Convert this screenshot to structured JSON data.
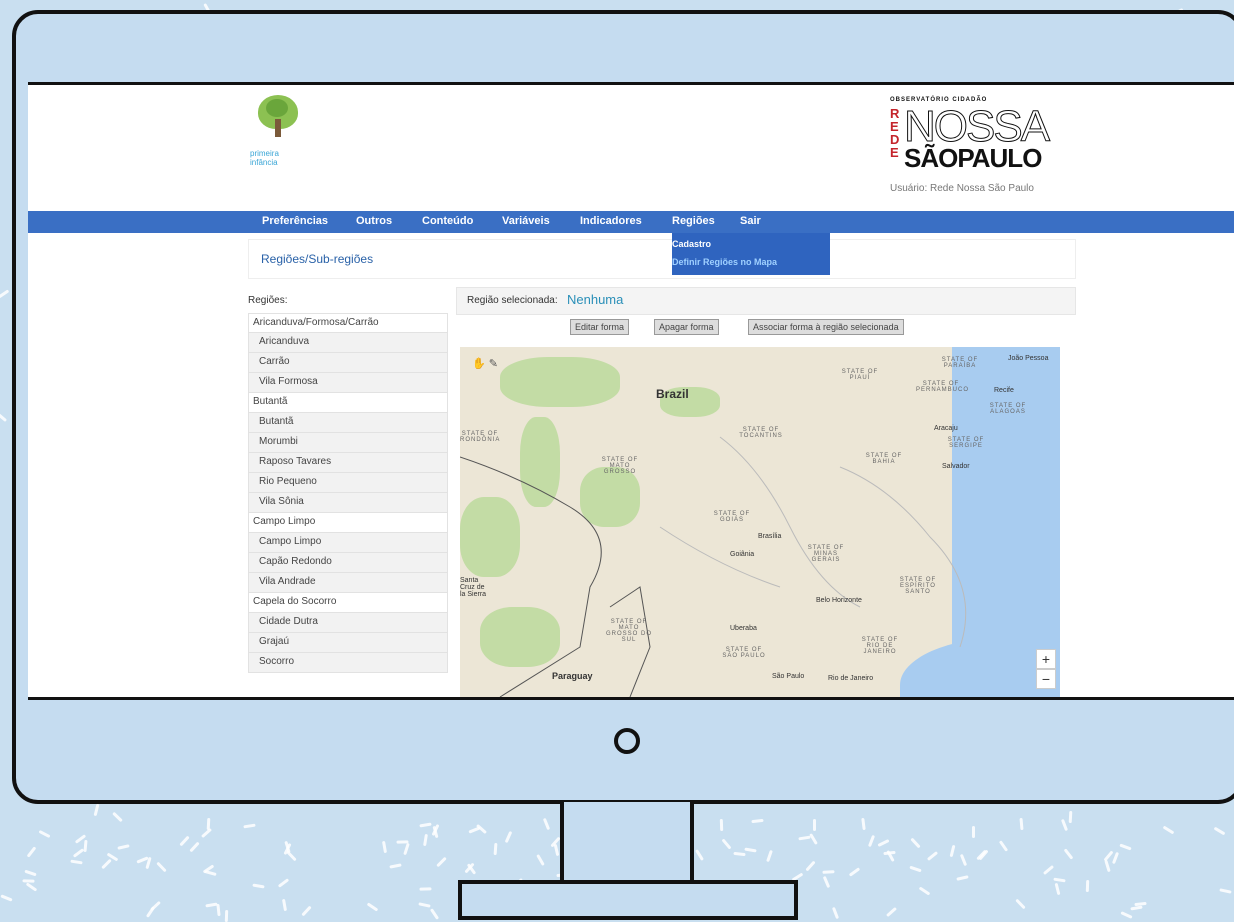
{
  "site": {
    "logo_left_text": "primeira infância",
    "logo_right_top": "OBSERVATÓRIO CIDADÃO",
    "logo_right_rede": "REDE",
    "logo_right_nossa": "NOSSA",
    "logo_right_sp": "SÃOPAULO",
    "user_label": "Usuário: Rede Nossa São Paulo"
  },
  "nav": {
    "items": [
      "Preferências",
      "Outros",
      "Conteúdo",
      "Variáveis",
      "Indicadores",
      "Regiões",
      "Sair"
    ],
    "dropdown": [
      "Cadastro",
      "Definir Regiões no Mapa"
    ]
  },
  "page": {
    "title": "Regiões/Sub-regiões",
    "regions_label": "Regiões:",
    "selected_label": "Região selecionada:",
    "selected_value": "Nenhuma",
    "buttons": [
      "Editar forma",
      "Apagar forma",
      "Associar forma à região selecionada"
    ]
  },
  "regions": [
    {
      "name": "Aricanduva/Formosa/Carrão",
      "sub": false
    },
    {
      "name": "Aricanduva",
      "sub": true
    },
    {
      "name": "Carrão",
      "sub": true
    },
    {
      "name": "Vila Formosa",
      "sub": true
    },
    {
      "name": "Butantã",
      "sub": false
    },
    {
      "name": "Butantã",
      "sub": true
    },
    {
      "name": "Morumbi",
      "sub": true
    },
    {
      "name": "Raposo Tavares",
      "sub": true
    },
    {
      "name": "Rio Pequeno",
      "sub": true
    },
    {
      "name": "Vila Sônia",
      "sub": true
    },
    {
      "name": "Campo Limpo",
      "sub": false
    },
    {
      "name": "Campo Limpo",
      "sub": true
    },
    {
      "name": "Capão Redondo",
      "sub": true
    },
    {
      "name": "Vila Andrade",
      "sub": true
    },
    {
      "name": "Capela do Socorro",
      "sub": false
    },
    {
      "name": "Cidade Dutra",
      "sub": true
    },
    {
      "name": "Grajaú",
      "sub": true
    },
    {
      "name": "Socorro",
      "sub": true
    }
  ],
  "map": {
    "country_brazil": "Brazil",
    "country_paraguay": "Paraguay",
    "states": [
      "STATE OF PIAUÍ",
      "STATE OF PARAÍBA",
      "STATE OF PERNAMBUCO",
      "STATE OF ALAGOAS",
      "STATE OF SERGIPE",
      "STATE OF TOCANTINS",
      "STATE OF MATO GROSSO",
      "STATE OF BAHIA",
      "STATE OF GOIÁS",
      "STATE OF MINAS GERAIS",
      "STATE OF ESPÍRITO SANTO",
      "STATE OF MATO GROSSO DO SUL",
      "STATE OF SÃO PAULO",
      "STATE OF RIO DE JANEIRO",
      "STATE OF RONDÔNIA"
    ],
    "cities": [
      "João Pessoa",
      "Recife",
      "Aracaju",
      "Salvador",
      "Brasília",
      "Goiânia",
      "Belo Horizonte",
      "São Paulo",
      "Rio de Janeiro",
      "Santa Cruz de la Sierra",
      "Uberaba"
    ],
    "zoom_in": "+",
    "zoom_out": "−"
  }
}
